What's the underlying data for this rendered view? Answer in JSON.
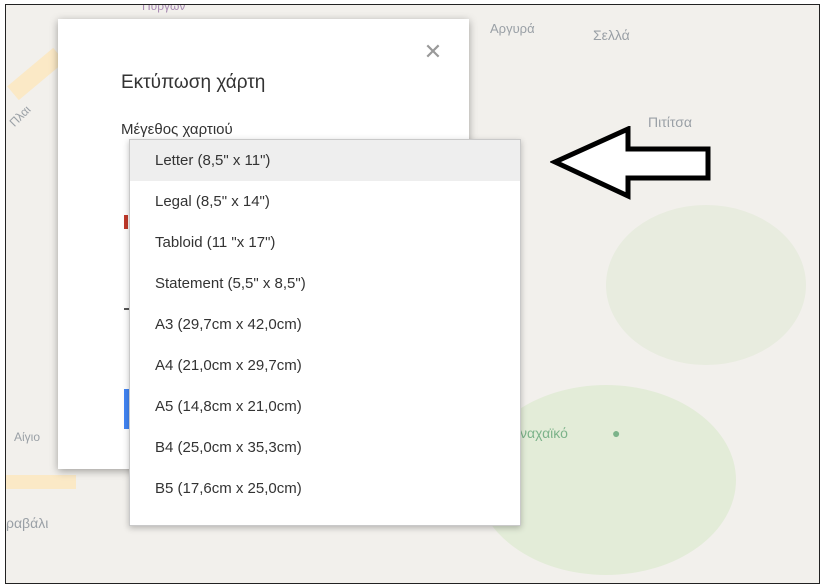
{
  "map": {
    "labels": [
      "Αργυρά",
      "Σελλά",
      "Πιτίτσα",
      "ναχαϊκό",
      "ραβάλι"
    ],
    "partial_labels": [
      "Πύργων",
      "Πλαι",
      "Αίγιο"
    ]
  },
  "dialog": {
    "title": "Εκτύπωση χάρτη",
    "paper_size_label": "Μέγεθος χαρτιού",
    "close_icon": "close-icon"
  },
  "dropdown": {
    "selected": "Letter (8,5\" x 11\")",
    "options": [
      "Letter (8,5\" x 11\")",
      "Legal (8,5\" x 14\")",
      "Tabloid (11 \"x 17\")",
      "Statement (5,5\" x 8,5\")",
      "A3 (29,7cm x 42,0cm)",
      "A4 (21,0cm x 29,7cm)",
      "A5 (14,8cm x 21,0cm)",
      "B4 (25,0cm x 35,3cm)",
      "B5 (17,6cm x 25,0cm)"
    ]
  },
  "annotation": {
    "arrow_icon": "left-arrow-icon"
  },
  "colors": {
    "map_bg": "#f2f0ec",
    "selected_row": "#eeeeee",
    "text": "#333333"
  }
}
